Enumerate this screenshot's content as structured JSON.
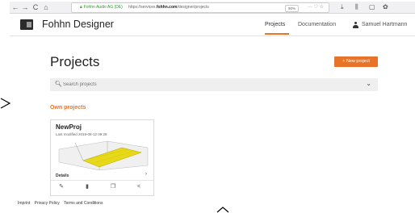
{
  "browser": {
    "back": "←",
    "forward": "→",
    "reload": "C",
    "home": "⌂",
    "lock_icon": "lock-icon",
    "site_name": "Fohhn Audio AG (DE)",
    "url_prefix": "https://services.",
    "url_host": "fohhn.com",
    "url_path": "/designer/projects",
    "zoom": "90%",
    "tail_icons": "··· ♡ ☆"
  },
  "app": {
    "brand": "Fohhn Designer",
    "nav": [
      "Projects",
      "Documentation"
    ],
    "user": "Samuel Hartmann"
  },
  "main": {
    "title": "Projects",
    "new_project": "+ New project",
    "search_placeholder": "Search projects",
    "section": "Own projects"
  },
  "project": {
    "name": "NewProj",
    "modified": "Last modified 2019-08-12 09:28",
    "details": "Details"
  },
  "footer": {
    "links": [
      "Imprint",
      "Privacy Policy",
      "Terms and Conditions"
    ]
  },
  "colors": {
    "accent": "#e8742a",
    "venue": "#e8d81a"
  }
}
